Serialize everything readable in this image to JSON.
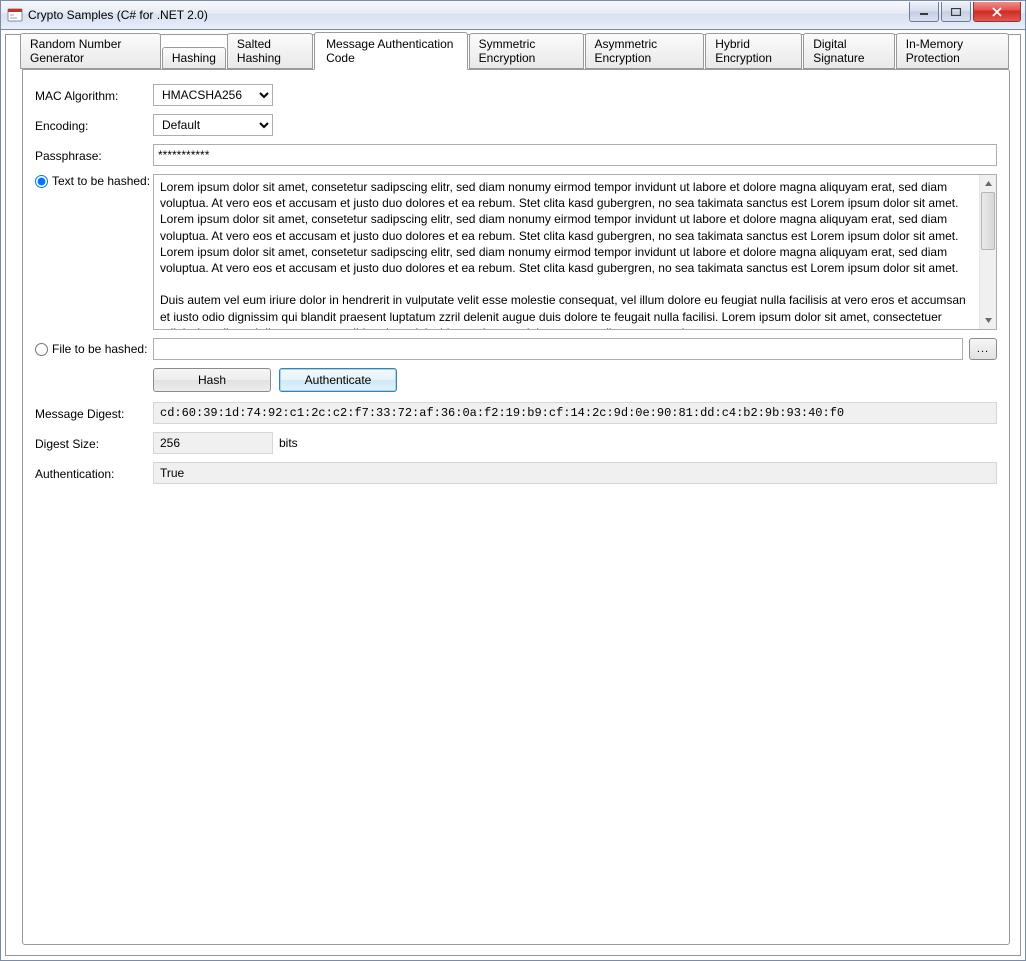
{
  "window": {
    "title": "Crypto Samples (C# for .NET 2.0)"
  },
  "tabs": {
    "all": [
      "Random Number Generator",
      "Hashing",
      "Salted Hashing",
      "Message Authentication Code",
      "Symmetric Encryption",
      "Asymmetric Encryption",
      "Hybrid Encryption",
      "Digital Signature",
      "In-Memory Protection"
    ],
    "active": "Message Authentication Code"
  },
  "labels": {
    "mac_algorithm": "MAC Algorithm:",
    "encoding": "Encoding:",
    "passphrase": "Passphrase:",
    "text_to_hash": "Text to be hashed:",
    "file_to_hash": "File to be hashed:",
    "message_digest": "Message Digest:",
    "digest_size": "Digest Size:",
    "authentication": "Authentication:",
    "bits": "bits"
  },
  "buttons": {
    "hash": "Hash",
    "authenticate": "Authenticate",
    "browse": "..."
  },
  "values": {
    "mac_algorithm": "HMACSHA256",
    "encoding": "Default",
    "passphrase": "***********",
    "text": "Lorem ipsum dolor sit amet, consetetur sadipscing elitr, sed diam nonumy eirmod tempor invidunt ut labore et dolore magna aliquyam erat, sed diam voluptua. At vero eos et accusam et justo duo dolores et ea rebum. Stet clita kasd gubergren, no sea takimata sanctus est Lorem ipsum dolor sit amet. Lorem ipsum dolor sit amet, consetetur sadipscing elitr, sed diam nonumy eirmod tempor invidunt ut labore et dolore magna aliquyam erat, sed diam voluptua. At vero eos et accusam et justo duo dolores et ea rebum. Stet clita kasd gubergren, no sea takimata sanctus est Lorem ipsum dolor sit amet. Lorem ipsum dolor sit amet, consetetur sadipscing elitr, sed diam nonumy eirmod tempor invidunt ut labore et dolore magna aliquyam erat, sed diam voluptua. At vero eos et accusam et justo duo dolores et ea rebum. Stet clita kasd gubergren, no sea takimata sanctus est Lorem ipsum dolor sit amet.\n\nDuis autem vel eum iriure dolor in hendrerit in vulputate velit esse molestie consequat, vel illum dolore eu feugiat nulla facilisis at vero eros et accumsan et iusto odio dignissim qui blandit praesent luptatum zzril delenit augue duis dolore te feugait nulla facilisi. Lorem ipsum dolor sit amet, consectetuer adipiscing elit, sed diam nonummy nibh euismod tincidunt ut laoreet dolore magna aliquam erat volutpat.\n\nUt wisi enim ad minim veniam, quis nostrud exerci tation ullamcorper suscipit lobortis nisl ut aliquip ex ea commodo consequat. Duis autem vel eum iriure dolor in hendrerit in",
    "file_path": "",
    "message_digest": "cd:60:39:1d:74:92:c1:2c:c2:f7:33:72:af:36:0a:f2:19:b9:cf:14:2c:9d:0e:90:81:dd:c4:b2:9b:93:40:f0",
    "digest_size": "256",
    "authentication": "True",
    "source_mode": "text"
  }
}
